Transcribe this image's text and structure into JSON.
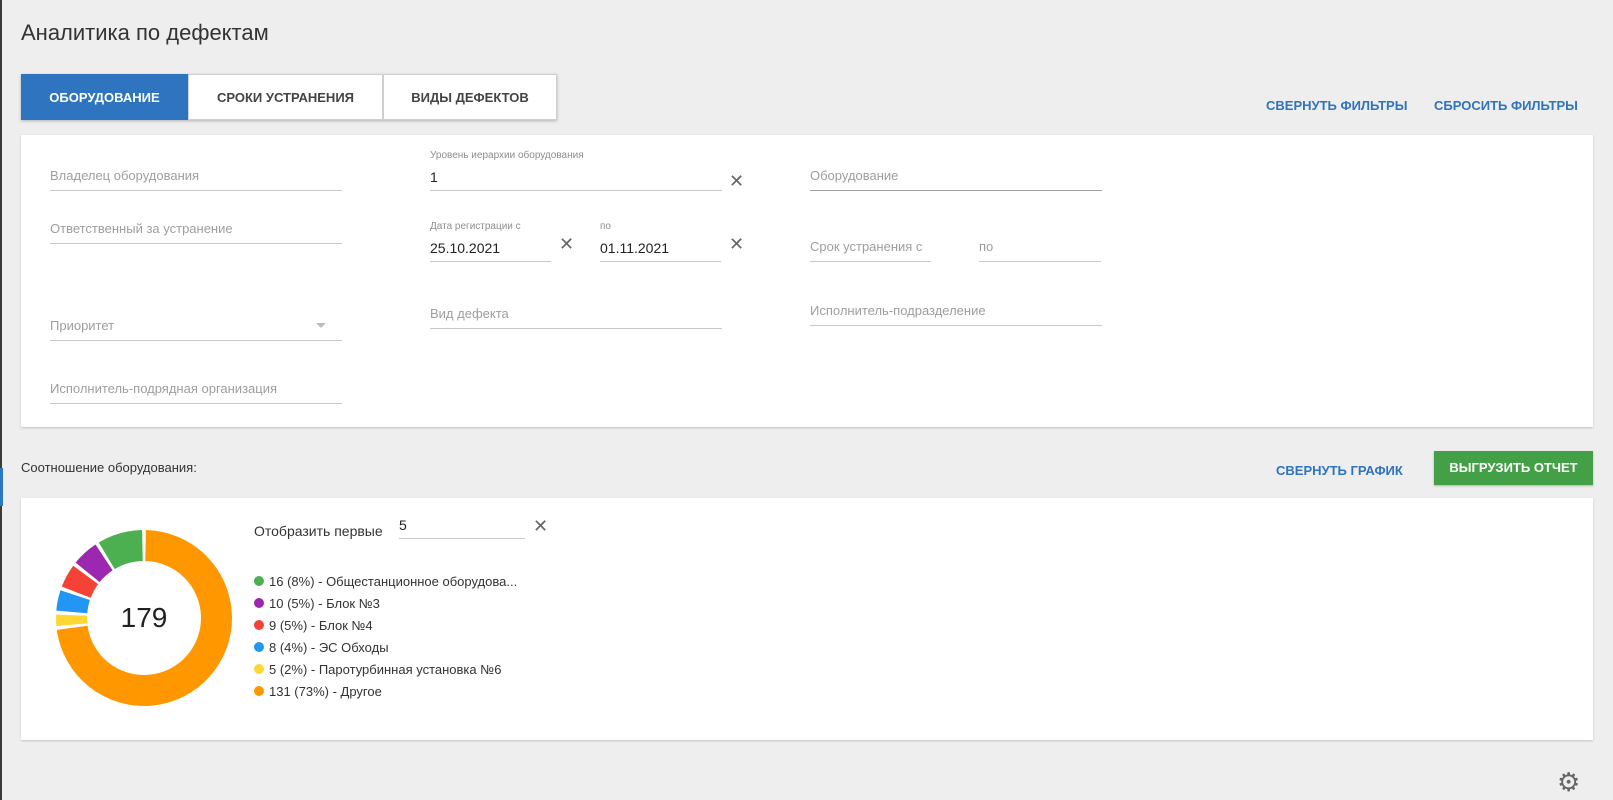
{
  "page": {
    "title": "Аналитика по дефектам"
  },
  "tabs": [
    {
      "label": "ОБОРУДОВАНИЕ",
      "active": true
    },
    {
      "label": "СРОКИ УСТРАНЕНИЯ",
      "active": false
    },
    {
      "label": "ВИДЫ ДЕФЕКТОВ",
      "active": false
    }
  ],
  "actions": {
    "collapse_filters": "СВЕРНУТЬ ФИЛЬТРЫ",
    "reset_filters": "СБРОСИТЬ ФИЛЬТРЫ",
    "collapse_chart": "СВЕРНУТЬ ГРАФИК",
    "export_report": "ВЫГРУЗИТЬ ОТЧЕТ"
  },
  "filters": {
    "owner": {
      "placeholder": "Владелец оборудования"
    },
    "hierarchy": {
      "label": "Уровень иерархии оборудования",
      "value": "1"
    },
    "equipment": {
      "placeholder": "Оборудование"
    },
    "responsible": {
      "placeholder": "Ответственный за устранение"
    },
    "reg_from": {
      "label": "Дата регистрации с",
      "value": "25.10.2021"
    },
    "reg_to": {
      "label": "по",
      "value": "01.11.2021"
    },
    "fix_from": {
      "placeholder": "Срок устранения с"
    },
    "fix_to": {
      "placeholder": "по"
    },
    "priority": {
      "placeholder": "Приоритет"
    },
    "defect_type": {
      "placeholder": "Вид дефекта"
    },
    "executor_unit": {
      "placeholder": "Исполнитель-подразделение"
    },
    "executor_contractor": {
      "placeholder": "Исполнитель-подрядная организация"
    }
  },
  "chart_section": {
    "title": "Соотношение оборудования:",
    "top_label": "Отобразить первые",
    "top_value": "5",
    "total": "179"
  },
  "chart_data": {
    "type": "pie",
    "categories": [
      "Общестанционное оборудова...",
      "Блок №3",
      "Блок №4",
      "ЭС Обходы",
      "Паротурбинная установка №6",
      "Другое"
    ],
    "values": [
      16,
      10,
      9,
      8,
      5,
      131
    ],
    "colors": [
      "#4caf50",
      "#9c27b0",
      "#f44336",
      "#2196f3",
      "#fdd835",
      "#ff9800"
    ],
    "legend": [
      "16 (8%) - Общестанционное оборудова...",
      "10 (5%) - Блок №3",
      "9 (5%) - Блок №4",
      "8 (4%) - ЭС Обходы",
      "5 (2%) - Паротурбинная установка №6",
      "131 (73%) - Другое"
    ],
    "total": 179
  },
  "icons": {
    "clear": "close-icon",
    "dropdown": "dropdown-arrow-icon",
    "settings": "gear-icon"
  }
}
